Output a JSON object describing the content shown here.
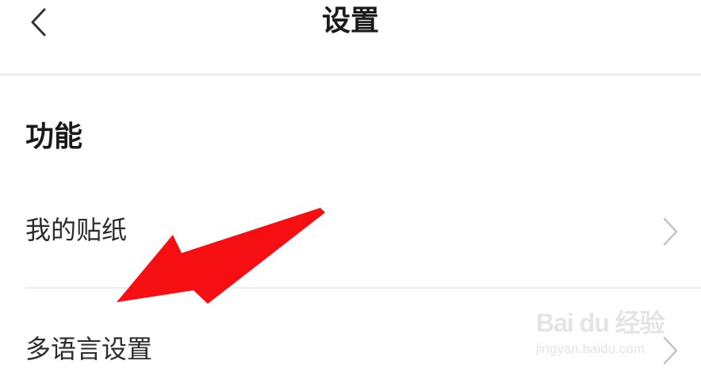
{
  "header": {
    "title": "设置",
    "back_icon": "chevron-left-icon"
  },
  "section": {
    "title": "功能"
  },
  "items": [
    {
      "label": "我的贴纸",
      "icon": "chevron-right-icon"
    },
    {
      "label": "多语言设置",
      "icon": "chevron-right-icon"
    }
  ],
  "annotation": {
    "icon": "red-arrow-pointer",
    "color": "#f50f12"
  },
  "watermark": {
    "brand": "Bai du 经验",
    "url": "jingyan.baidu.com"
  }
}
